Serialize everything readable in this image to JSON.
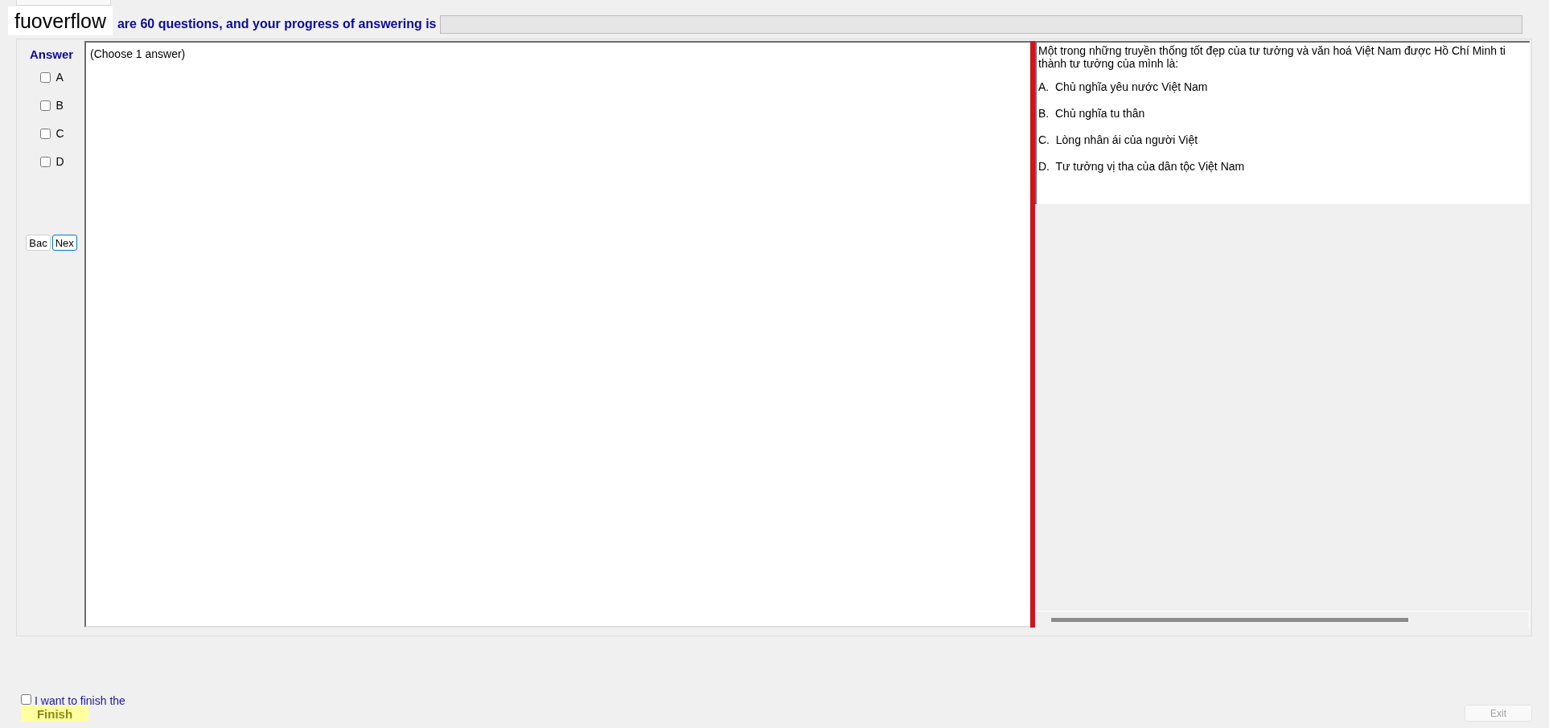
{
  "logo": "fuoverflow",
  "header": {
    "text": "are 60 questions, and your progress of answering is",
    "progress": {
      "level": 0
    }
  },
  "answer_panel": {
    "title": "Answer",
    "options": [
      {
        "label": "A",
        "checked": false
      },
      {
        "label": "B",
        "checked": false
      },
      {
        "label": "C",
        "checked": false
      },
      {
        "label": "D",
        "checked": false
      }
    ],
    "buttons": [
      {
        "label": "Bac",
        "selected": false
      },
      {
        "label": "Nex",
        "selected": true
      }
    ]
  },
  "answer_area": {
    "text": "(Choose 1 answer)"
  },
  "question": {
    "text": "Một trong những truyền thống tốt đẹp của tư tưởng và văn hoá Việt Nam được Hồ Chí Minh ti",
    "text_line_2": "thành tư tưởng của mình là:",
    "choices": [
      "A.  Chủ nghĩa yêu nước Việt Nam",
      "B.  Chủ nghĩa tu thân",
      "C.  Lòng nhân ái của người Việt",
      "D.  Tư tưởng vị tha của dân tộc Việt Nam"
    ]
  },
  "finish": {
    "checkbox_label": "I want to finish the",
    "checked": false,
    "button": "Finish"
  },
  "exit": {
    "label": "Exit",
    "disabled": true
  }
}
